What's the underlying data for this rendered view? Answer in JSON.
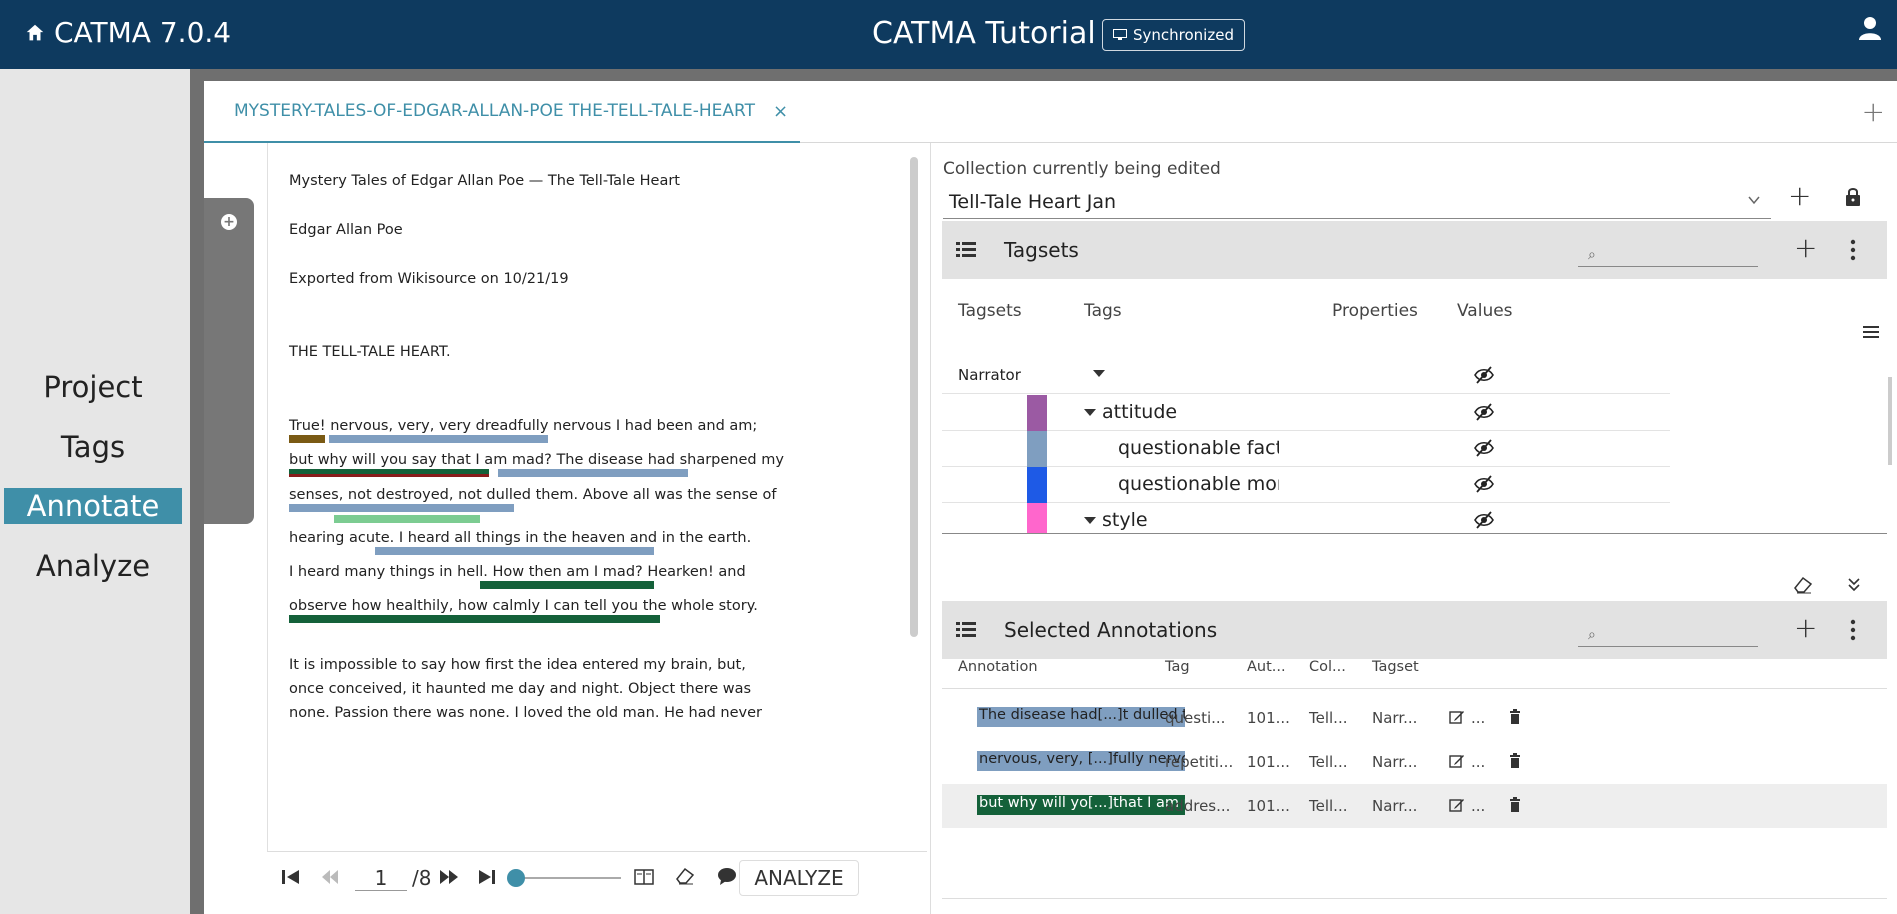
{
  "app": {
    "name": "CATMA 7.0.4",
    "project_title": "CATMA Tutorial",
    "sync_label": "Synchronized"
  },
  "nav": {
    "items": [
      {
        "label": "Project"
      },
      {
        "label": "Tags"
      },
      {
        "label": "Annotate",
        "active": true
      },
      {
        "label": "Analyze"
      }
    ]
  },
  "tab": {
    "label": "MYSTERY-TALES-OF-EDGAR-ALLAN-POE THE-TELL-TALE-HEART",
    "close": "×",
    "add": "+"
  },
  "document": {
    "lines": [
      "Mystery Tales of Edgar Allan Poe — The Tell-Tale Heart",
      "Edgar Allan Poe",
      "Exported from Wikisource on 10/21/19",
      "THE TELL-TALE HEART.",
      "True! nervous, very, very dreadfully nervous I had been and am;",
      "but why will you say that I am mad? The disease had sharpened my",
      "senses, not destroyed, not dulled them. Above all was the sense of",
      " hearing acute. I heard all things in the heaven and in the earth.",
      " I heard many things in hell. How then am I mad? Hearken! and",
      "observe how healthily, how calmly I can tell you the whole story.",
      "It is impossible to say how first the idea entered my brain, but,",
      "once conceived, it haunted me day and night. Object there was",
      "none. Passion there was none. I loved the old man. He had never"
    ]
  },
  "pager": {
    "current_page": "1",
    "total": "/8",
    "analyze_label": "ANALYZE"
  },
  "collection": {
    "label": "Collection currently being edited",
    "selected": "Tell-Tale Heart Jan",
    "add": "+"
  },
  "tagsets": {
    "title": "Tagsets",
    "search_placeholder": "⌕",
    "add": "+",
    "columns": [
      "Tagsets",
      "Tags",
      "Properties",
      "Values"
    ],
    "rows": [
      {
        "tagset": "Narrator",
        "tag": "",
        "color": ""
      },
      {
        "tagset": "",
        "tag": "attitude",
        "color": "#9b5aa3"
      },
      {
        "tagset": "",
        "tag": "questionable fact",
        "color": "#7f9ec0"
      },
      {
        "tagset": "",
        "tag": "questionable mor",
        "color": "#1e5ae6"
      },
      {
        "tagset": "",
        "tag": "style",
        "color": "#ff66cc"
      }
    ]
  },
  "annotations": {
    "title": "Selected Annotations",
    "search_placeholder": "⌕",
    "add": "+",
    "columns": [
      "Annotation",
      "Tag",
      "Aut...",
      "Col...",
      "Tagset"
    ],
    "rows": [
      {
        "text": "The disease had[...]t dulled the",
        "tag": "questi...",
        "author": "101...",
        "collection": "Tell...",
        "tagset": "Narr...",
        "more": "...",
        "color": "#7f9ec0",
        "text_color": "#222"
      },
      {
        "text": "nervous, very, [...]fully nervous",
        "tag": "repetiti...",
        "author": "101...",
        "collection": "Tell...",
        "tagset": "Narr...",
        "more": "...",
        "color": "#7f9ec0",
        "text_color": "#222"
      },
      {
        "text": "but why will yo[...]that I am ma",
        "tag": "addres...",
        "author": "101...",
        "collection": "Tell...",
        "tagset": "Narr...",
        "more": "...",
        "color": "#14613a",
        "text_color": "#fff"
      }
    ]
  },
  "colors": {
    "header_bg": "#0e3a5f",
    "accent": "#3f8fa8",
    "brown": "#7a5a14",
    "blue_gray": "#7f9ec0",
    "dark_green": "#14613a",
    "light_green": "#7ccc92",
    "dark_red": "#8a1c1c"
  }
}
